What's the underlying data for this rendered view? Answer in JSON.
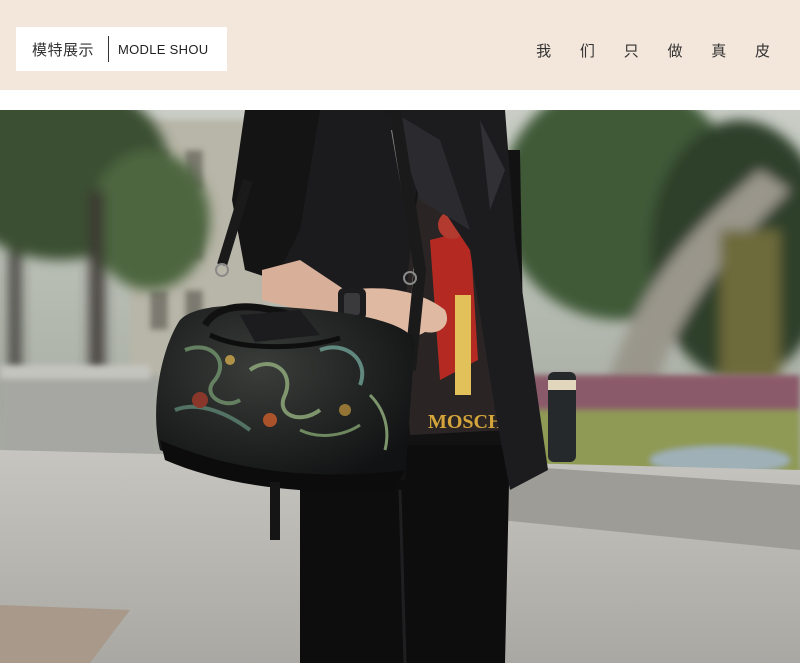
{
  "header": {
    "label_cn": "模特展示",
    "label_en": "MODLE SHOU",
    "tagline": "我 们 只 做 真 皮"
  },
  "photo": {
    "shirt_print": "MOSCHINO",
    "colors": {
      "banner_bg": "#f3e6da",
      "jacket": "#1b1b1d",
      "foliage": "#3f5a37",
      "pavement": "#b9b8b3",
      "print_gold": "#d4a53a"
    }
  }
}
